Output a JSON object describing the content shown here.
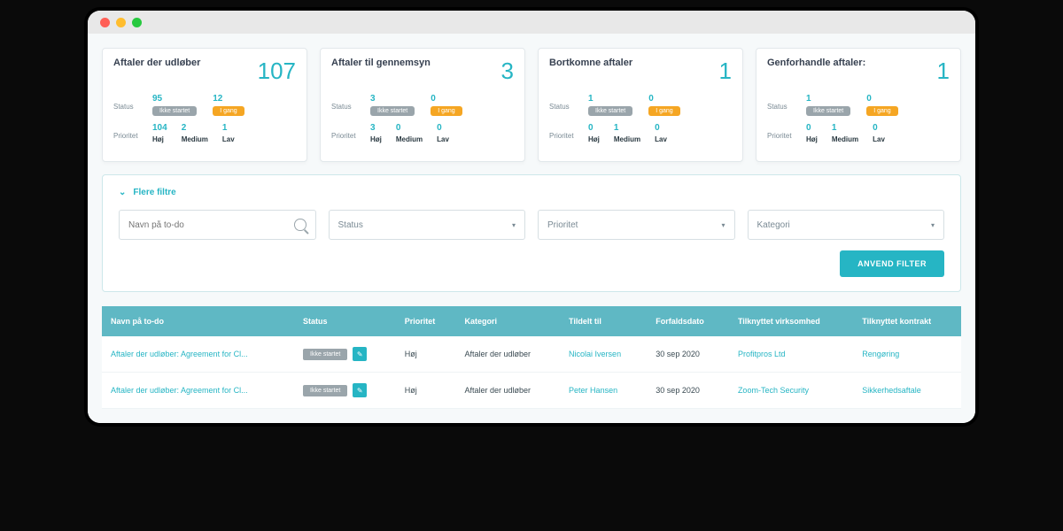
{
  "cards": [
    {
      "title": "Aftaler der udløber",
      "count": "107",
      "status_label": "Status",
      "s1_num": "95",
      "s1_badge": "Ikke startet",
      "s2_num": "12",
      "s2_badge": "I gang",
      "prio_label": "Prioritet",
      "p_hoj_n": "104",
      "p_hoj_l": "Høj",
      "p_med_n": "2",
      "p_med_l": "Medium",
      "p_lav_n": "1",
      "p_lav_l": "Lav"
    },
    {
      "title": "Aftaler til gennemsyn",
      "count": "3",
      "status_label": "Status",
      "s1_num": "3",
      "s1_badge": "Ikke startet",
      "s2_num": "0",
      "s2_badge": "I gang",
      "prio_label": "Prioritet",
      "p_hoj_n": "3",
      "p_hoj_l": "Høj",
      "p_med_n": "0",
      "p_med_l": "Medium",
      "p_lav_n": "0",
      "p_lav_l": "Lav"
    },
    {
      "title": "Bortkomne aftaler",
      "count": "1",
      "status_label": "Status",
      "s1_num": "1",
      "s1_badge": "Ikke startet",
      "s2_num": "0",
      "s2_badge": "I gang",
      "prio_label": "Prioritet",
      "p_hoj_n": "0",
      "p_hoj_l": "Høj",
      "p_med_n": "1",
      "p_med_l": "Medium",
      "p_lav_n": "0",
      "p_lav_l": "Lav"
    },
    {
      "title": "Genforhandle aftaler:",
      "count": "1",
      "status_label": "Status",
      "s1_num": "1",
      "s1_badge": "Ikke startet",
      "s2_num": "0",
      "s2_badge": "I gang",
      "prio_label": "Prioritet",
      "p_hoj_n": "0",
      "p_hoj_l": "Høj",
      "p_med_n": "1",
      "p_med_l": "Medium",
      "p_lav_n": "0",
      "p_lav_l": "Lav"
    }
  ],
  "filters": {
    "toggle_label": "Flere filtre",
    "name_placeholder": "Navn på to-do",
    "status_label": "Status",
    "priority_label": "Prioritet",
    "category_label": "Kategori",
    "apply_label": "ANVEND FILTER"
  },
  "table": {
    "headers": {
      "name": "Navn på to-do",
      "status": "Status",
      "priority": "Prioritet",
      "category": "Kategori",
      "assigned": "Tildelt til",
      "due": "Forfaldsdato",
      "company": "Tilknyttet virksomhed",
      "contract": "Tilknyttet kontrakt"
    },
    "rows": [
      {
        "name": "Aftaler der udløber: Agreement for Cl...",
        "status_badge": "Ikke startet",
        "priority": "Høj",
        "category": "Aftaler der udløber",
        "assigned": "Nicolai Iversen",
        "due": "30 sep 2020",
        "company": "Profitpros Ltd",
        "contract": "Rengøring"
      },
      {
        "name": "Aftaler der udløber: Agreement for Cl...",
        "status_badge": "Ikke startet",
        "priority": "Høj",
        "category": "Aftaler der udløber",
        "assigned": "Peter Hansen",
        "due": "30 sep 2020",
        "company": "Zoom-Tech Security",
        "contract": "Sikkerhedsaftale"
      }
    ]
  }
}
